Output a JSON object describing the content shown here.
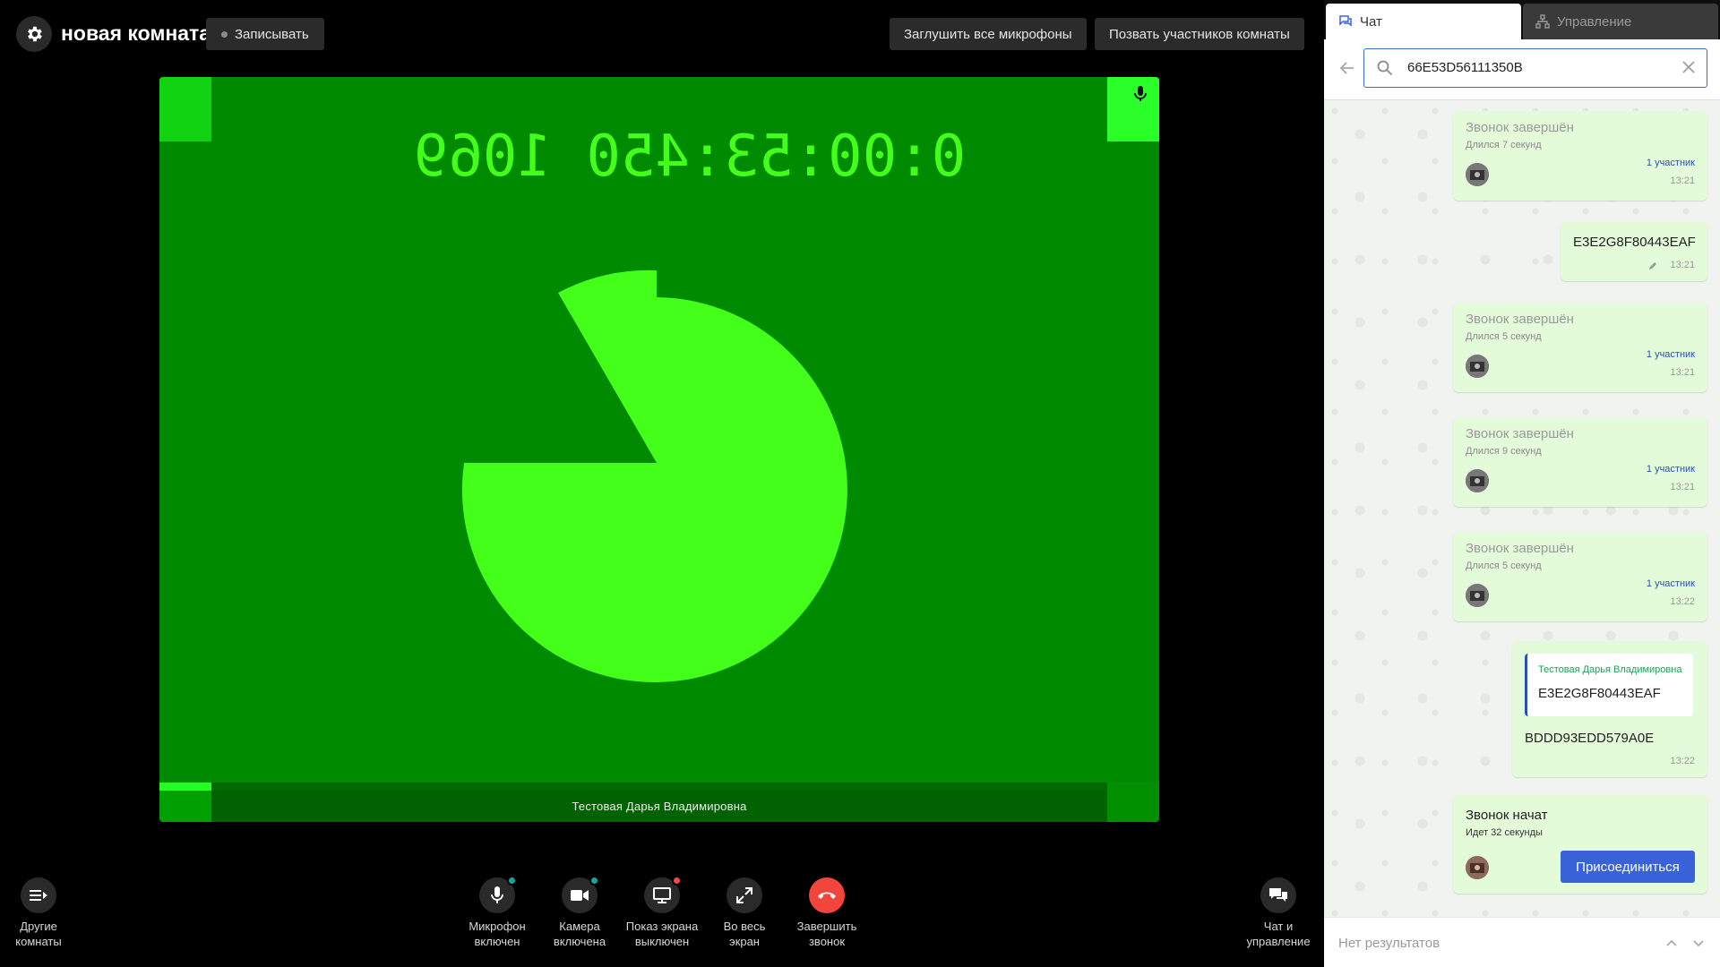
{
  "room": {
    "title": "новая комната",
    "record_label": "Записывать"
  },
  "topbar": {
    "mute_all_label": "Заглушить все микрофоны",
    "call_participants_label": "Позвать участников комнаты"
  },
  "video": {
    "timestamp_text": "0:00:53:450 1069",
    "participant_name": "Тестовая Дарья Владимировна"
  },
  "controls": {
    "other_rooms": "Другие\nкомнаты",
    "mic": "Микрофон\nвключен",
    "camera": "Камера\nвключена",
    "screen_share": "Показ экрана\nвыключен",
    "fullscreen": "Во весь\nэкран",
    "end_call": "Завершить\nзвонок",
    "chat_manage": "Чат и\nуправление",
    "mic_badge_color": "#1aa39a",
    "camera_badge_color": "#1aa39a",
    "screen_badge_color": "#ef4b4b",
    "end_call_color": "#f2453d"
  },
  "panel": {
    "tab_chat": "Чат",
    "tab_manage": "Управление",
    "search_value": "66E53D56111350B",
    "no_results": "Нет результатов"
  },
  "messages": [
    {
      "type": "call_ended",
      "title": "Звонок завершён",
      "duration": "Длился 7 секунд",
      "participants": "1 участник",
      "time": "13:21"
    },
    {
      "type": "text",
      "text": "E3E2G8F80443EAF",
      "time": "13:21",
      "edited": true
    },
    {
      "type": "call_ended",
      "title": "Звонок завершён",
      "duration": "Длился 5 секунд",
      "participants": "1 участник",
      "time": "13:21"
    },
    {
      "type": "call_ended",
      "title": "Звонок завершён",
      "duration": "Длился 9 секунд",
      "participants": "1 участник",
      "time": "13:21"
    },
    {
      "type": "call_ended",
      "title": "Звонок завершён",
      "duration": "Длился 5 секунд",
      "participants": "1 участник",
      "time": "13:22"
    },
    {
      "type": "reply",
      "quote_author": "Тестовая Дарья Владимировна",
      "quote_text": "E3E2G8F80443EAF",
      "text": "BDDD93EDD579A0E",
      "time": "13:22"
    },
    {
      "type": "call_started",
      "title": "Звонок начат",
      "duration": "Идет 32 секунды",
      "join_label": "Присоединиться"
    }
  ]
}
